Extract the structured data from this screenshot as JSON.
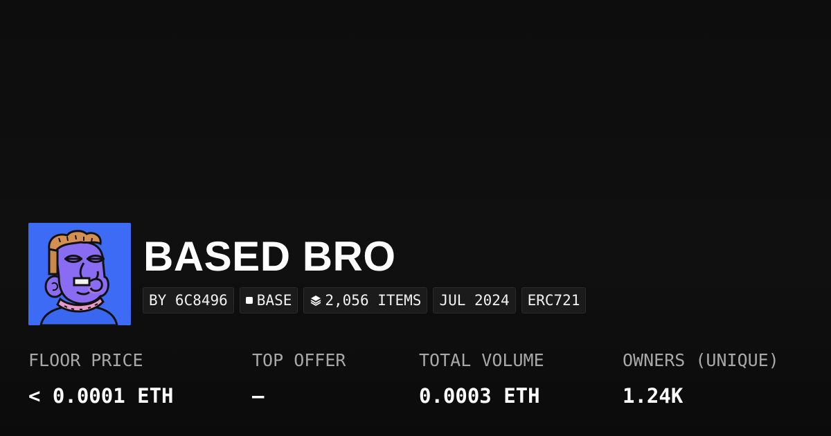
{
  "collection": {
    "title": "BASED BRO",
    "avatar_icon": "cartoon-avatar-icon",
    "avatar_bg": "#3d6bf5"
  },
  "chips": {
    "creator": "BY 6C8496",
    "chain": "BASE",
    "chain_icon": "square-icon",
    "items": "2,056 ITEMS",
    "items_icon": "layers-icon",
    "date": "JUL 2024",
    "standard": "ERC721"
  },
  "stats": [
    {
      "label": "FLOOR PRICE",
      "value": "< 0.0001 ETH"
    },
    {
      "label": "TOP OFFER",
      "value": "–"
    },
    {
      "label": "TOTAL VOLUME",
      "value": "0.0003 ETH"
    },
    {
      "label": "OWNERS (UNIQUE)",
      "value": "1.24K"
    }
  ]
}
